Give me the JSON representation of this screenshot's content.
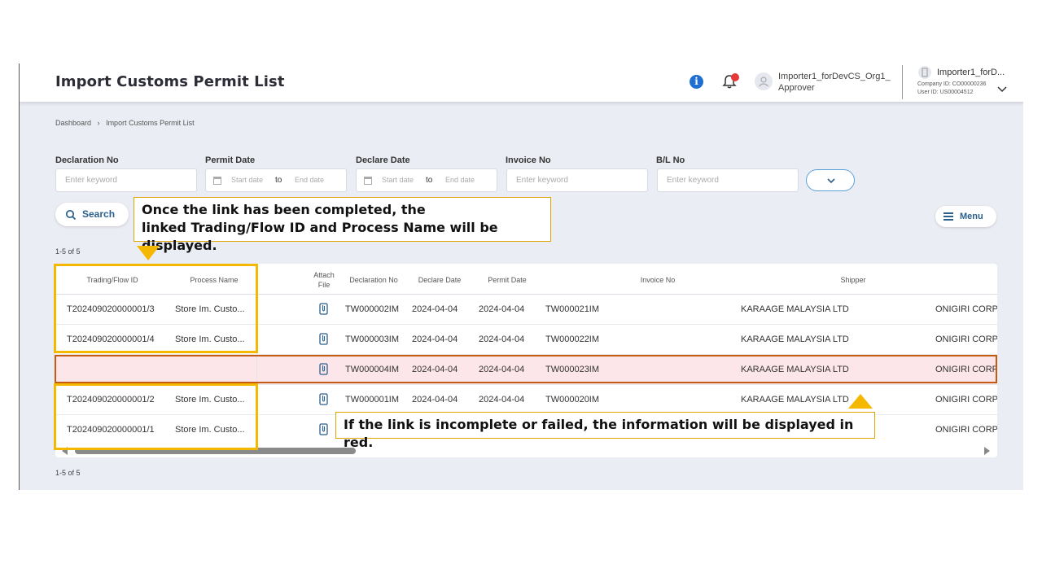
{
  "header": {
    "title": "Import Customs Permit List",
    "user_name": "Importer1_forDevCS_Org1_",
    "user_role": "Approver",
    "account_name": "Importer1_forD...",
    "company_id": "Company ID: CO00000236",
    "user_id": "User ID: US00004512"
  },
  "breadcrumb": {
    "items": [
      "Dashboard",
      "›",
      "Import Customs Permit List"
    ]
  },
  "filters": {
    "declaration_no": {
      "label": "Declaration No",
      "placeholder": "Enter keyword"
    },
    "permit_date": {
      "label": "Permit Date",
      "start": "Start date",
      "to": "to",
      "end": "End date"
    },
    "declare_date": {
      "label": "Declare Date",
      "start": "Start date",
      "to": "to",
      "end": "End date"
    },
    "invoice_no": {
      "label": "Invoice No",
      "placeholder": "Enter keyword"
    },
    "bl_no": {
      "label": "B/L No",
      "placeholder": "Enter keyword"
    }
  },
  "actions": {
    "search_label": "Search",
    "menu_label": "Menu"
  },
  "pagination": {
    "top_count": "1-5 of 5",
    "bottom_count": "1-5 of 5"
  },
  "table": {
    "headers": {
      "trading_flow_id": "Trading/Flow ID",
      "process_name": "Process Name",
      "attach_file": "Attach File",
      "declaration_no": "Declaration No",
      "declare_date": "Declare Date",
      "permit_date": "Permit Date",
      "invoice_no": "Invoice No",
      "shipper": "Shipper"
    },
    "rows": [
      {
        "flow_id": "T202409020000001/3",
        "process": "Store Im. Custo...",
        "declaration_no": "TW000002IM",
        "declare_date": "2024-04-04",
        "permit_date": "2024-04-04",
        "invoice_no": "TW000021IM",
        "shipper": "KARAAGE MALAYSIA LTD",
        "consignee": "ONIGIRI CORPO"
      },
      {
        "flow_id": "T202409020000001/4",
        "process": "Store Im. Custo...",
        "declaration_no": "TW000003IM",
        "declare_date": "2024-04-04",
        "permit_date": "2024-04-04",
        "invoice_no": "TW000022IM",
        "shipper": "KARAAGE MALAYSIA LTD",
        "consignee": "ONIGIRI CORPO"
      },
      {
        "flow_id": "",
        "process": "",
        "declaration_no": "TW000004IM",
        "declare_date": "2024-04-04",
        "permit_date": "2024-04-04",
        "invoice_no": "TW000023IM",
        "shipper": "KARAAGE MALAYSIA LTD",
        "consignee": "ONIGIRI CORPO"
      },
      {
        "flow_id": "T202409020000001/2",
        "process": "Store Im. Custo...",
        "declaration_no": "TW000001IM",
        "declare_date": "2024-04-04",
        "permit_date": "2024-04-04",
        "invoice_no": "TW000020IM",
        "shipper": "KARAAGE MALAYSIA LTD",
        "consignee": "ONIGIRI CORPO"
      },
      {
        "flow_id": "T202409020000001/1",
        "process": "Store Im. Custo...",
        "declaration_no": "",
        "declare_date": "",
        "permit_date": "",
        "invoice_no": "",
        "shipper": "",
        "consignee": "ONIGIRI CORPO"
      }
    ]
  },
  "annotations": {
    "top_callout_line1": "Once the link has been completed, the",
    "top_callout_line2": "linked Trading/Flow ID and Process Name will be displayed.",
    "bottom_callout": "If the link is incomplete or failed, the information will be displayed in red."
  },
  "colors": {
    "highlight": "#f5b800",
    "error_border": "#c55a11",
    "error_row": "#fde6e9",
    "accent": "#2b5f8d",
    "info": "#1f6fd1"
  }
}
